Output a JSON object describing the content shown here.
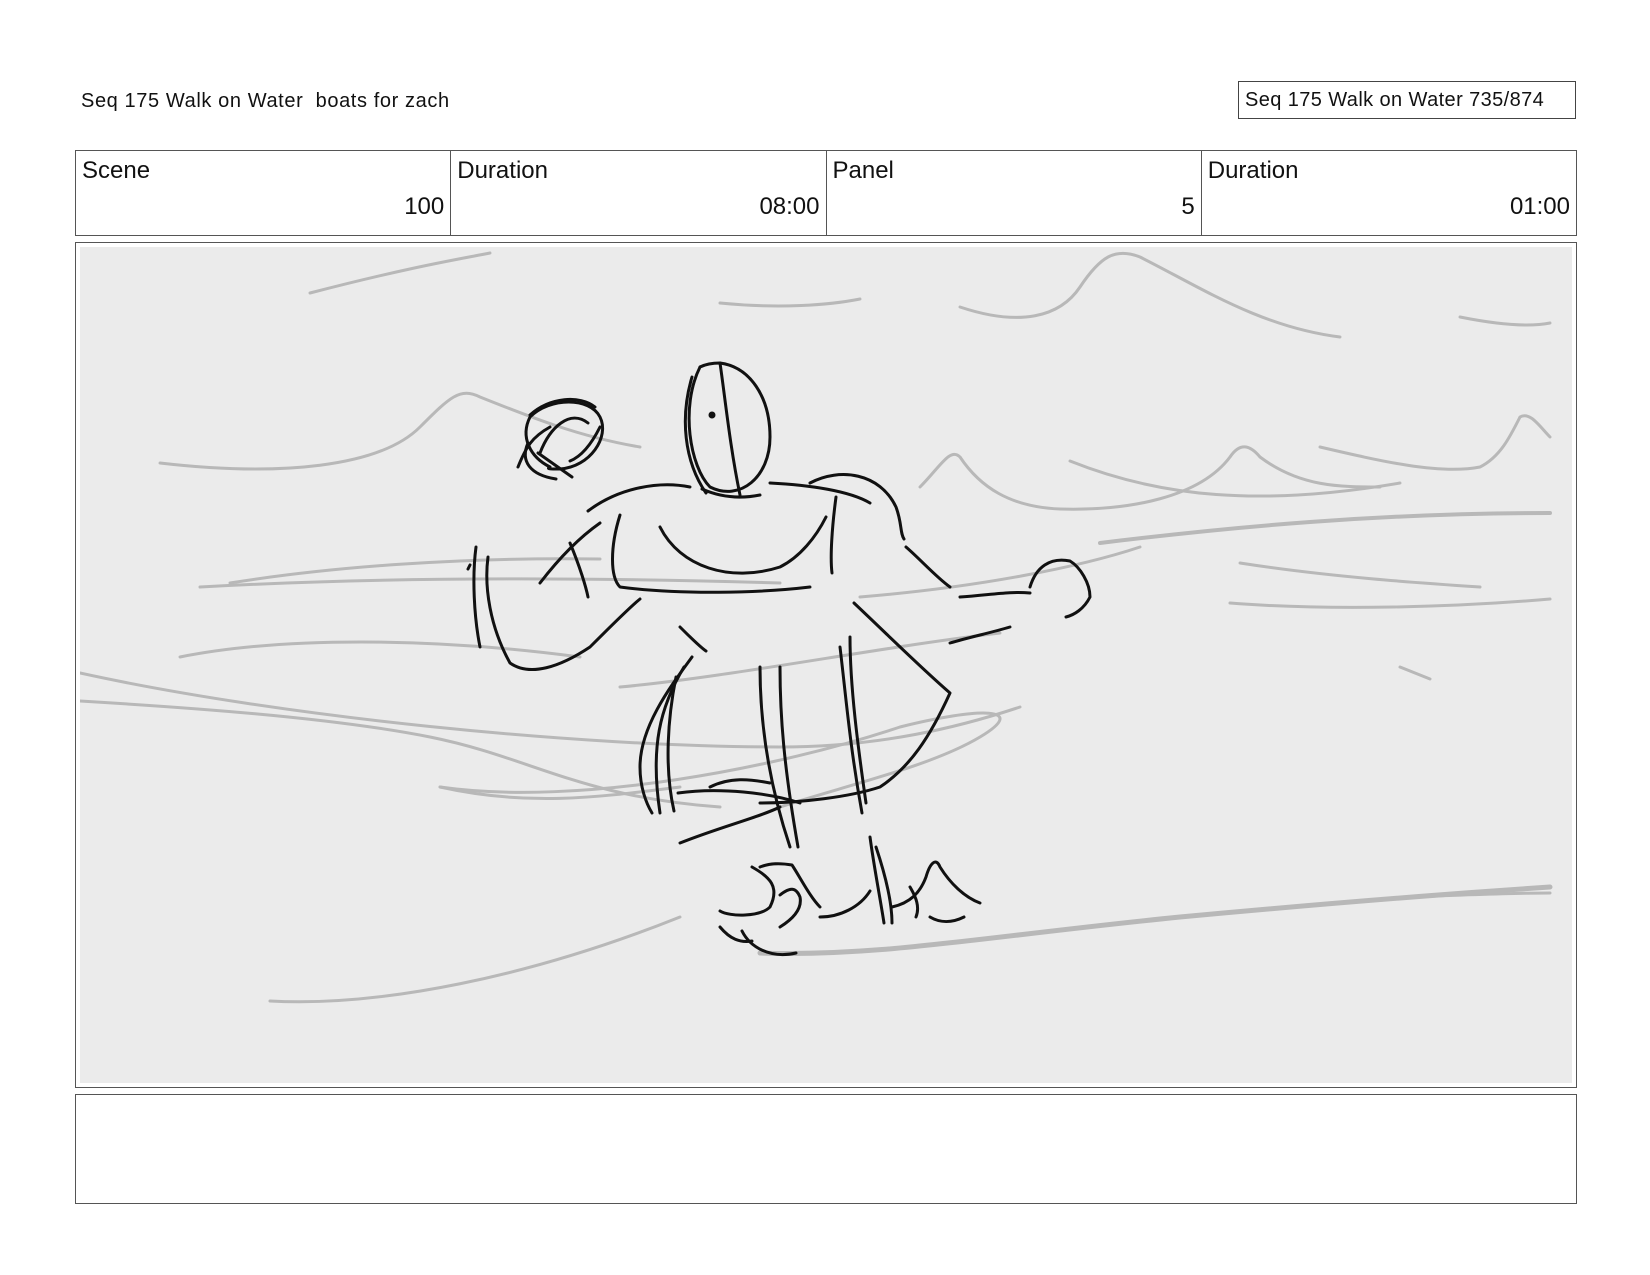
{
  "header": {
    "title": "Seq 175 Walk on Water  boats for zach",
    "page_counter": "Seq 175 Walk on Water 735/874"
  },
  "info": [
    {
      "label": "Scene",
      "value": "100"
    },
    {
      "label": "Duration",
      "value": "08:00"
    },
    {
      "label": "Panel",
      "value": "5"
    },
    {
      "label": "Duration",
      "value": "01:00"
    }
  ],
  "panel": {
    "background_color": "#ebebeb",
    "sketch_color": "#111111",
    "water_line_color": "#b8b8b8"
  },
  "notes": {
    "text": ""
  }
}
